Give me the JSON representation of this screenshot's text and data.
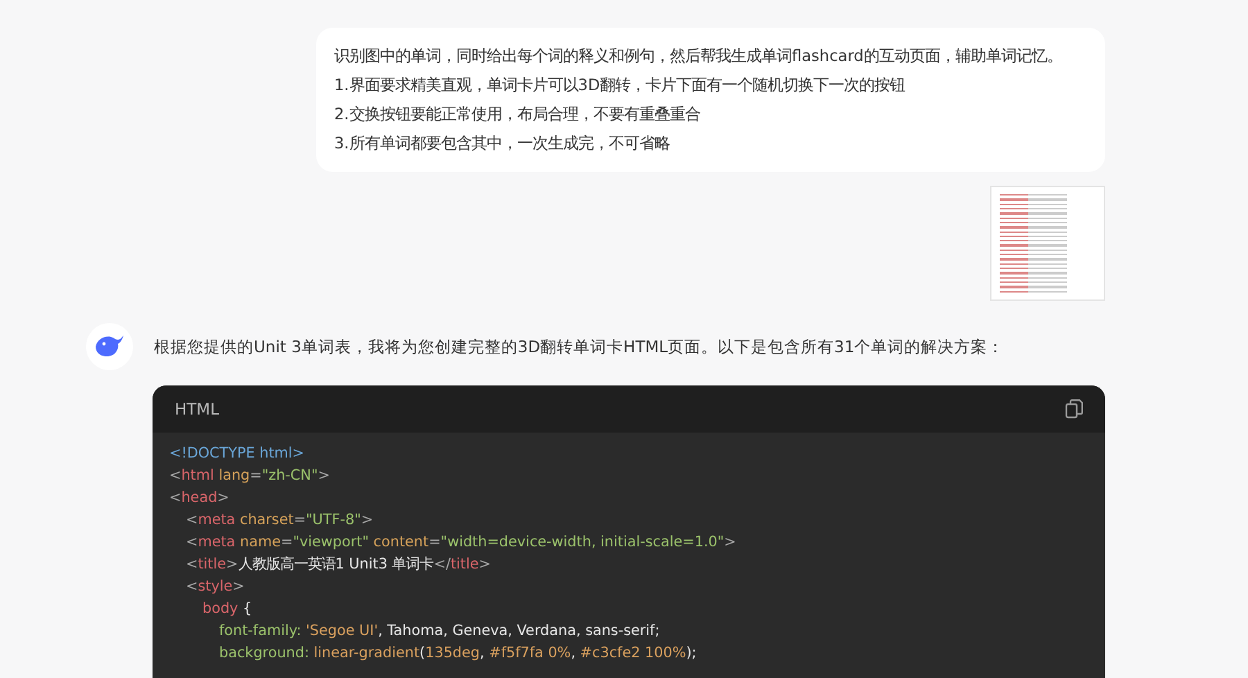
{
  "user_message": {
    "lines": [
      "识别图中的单词，同时给出每个词的释义和例句，然后帮我生成单词flashcard的互动页面，辅助单词记忆。",
      "1.界面要求精美直观，单词卡片可以3D翻转，卡片下面有一个随机切换下一次的按钮",
      "2.交换按钮要能正常使用，布局合理，不要有重叠重合",
      "3.所有单词都要包含其中，一次生成完，不可省略"
    ]
  },
  "assistant_message": {
    "text": "根据您提供的Unit 3单词表，我将为您创建完整的3D翻转单词卡HTML页面。以下是包含所有31个单词的解决方案：",
    "code_block": {
      "language": "HTML",
      "lines": [
        {
          "tokens": [
            {
              "kind": "doctype",
              "text": "<!DOCTYPE html>"
            }
          ]
        },
        {
          "tokens": [
            {
              "kind": "punct",
              "text": "<"
            },
            {
              "kind": "tag",
              "text": "html"
            },
            {
              "kind": "attr",
              "text": " lang"
            },
            {
              "kind": "punct",
              "text": "="
            },
            {
              "kind": "str",
              "text": "\"zh-CN\""
            },
            {
              "kind": "punct",
              "text": ">"
            }
          ]
        },
        {
          "tokens": [
            {
              "kind": "punct",
              "text": "<"
            },
            {
              "kind": "tag",
              "text": "head"
            },
            {
              "kind": "punct",
              "text": ">"
            }
          ],
          "children": [
            {
              "tokens": [
                {
                  "kind": "punct",
                  "text": "<"
                },
                {
                  "kind": "tag",
                  "text": "meta"
                },
                {
                  "kind": "attr",
                  "text": " charset"
                },
                {
                  "kind": "punct",
                  "text": "="
                },
                {
                  "kind": "str",
                  "text": "\"UTF-8\""
                },
                {
                  "kind": "punct",
                  "text": ">"
                }
              ]
            },
            {
              "tokens": [
                {
                  "kind": "punct",
                  "text": "<"
                },
                {
                  "kind": "tag",
                  "text": "meta"
                },
                {
                  "kind": "attr",
                  "text": " name"
                },
                {
                  "kind": "punct",
                  "text": "="
                },
                {
                  "kind": "str",
                  "text": "\"viewport\""
                },
                {
                  "kind": "attr",
                  "text": " content"
                },
                {
                  "kind": "punct",
                  "text": "="
                },
                {
                  "kind": "str",
                  "text": "\"width=device-width, initial-scale=1.0\""
                },
                {
                  "kind": "punct",
                  "text": ">"
                }
              ]
            },
            {
              "tokens": [
                {
                  "kind": "punct",
                  "text": "<"
                },
                {
                  "kind": "tag",
                  "text": "title"
                },
                {
                  "kind": "punct",
                  "text": ">"
                },
                {
                  "kind": "text",
                  "text": "人教版高一英语1 Unit3 单词卡"
                },
                {
                  "kind": "punct",
                  "text": "</"
                },
                {
                  "kind": "tag",
                  "text": "title"
                },
                {
                  "kind": "punct",
                  "text": ">"
                }
              ]
            },
            {
              "tokens": [
                {
                  "kind": "punct",
                  "text": "<"
                },
                {
                  "kind": "tag",
                  "text": "style"
                },
                {
                  "kind": "punct",
                  "text": ">"
                }
              ],
              "children": [
                {
                  "tokens": [
                    {
                      "kind": "tag",
                      "text": "body"
                    },
                    {
                      "kind": "text",
                      "text": " {"
                    }
                  ],
                  "children": [
                    {
                      "tokens": [
                        {
                          "kind": "prop",
                          "text": "font-family:"
                        },
                        {
                          "kind": "num",
                          "text": " 'Segoe UI'"
                        },
                        {
                          "kind": "text",
                          "text": ", Tahoma, Geneva, Verdana, sans-serif;"
                        }
                      ]
                    },
                    {
                      "tokens": [
                        {
                          "kind": "prop",
                          "text": "background:"
                        },
                        {
                          "kind": "num",
                          "text": " linear-gradient"
                        },
                        {
                          "kind": "text",
                          "text": "("
                        },
                        {
                          "kind": "num",
                          "text": "135deg"
                        },
                        {
                          "kind": "text",
                          "text": ", "
                        },
                        {
                          "kind": "num",
                          "text": "#f5f7fa 0%"
                        },
                        {
                          "kind": "text",
                          "text": ", "
                        },
                        {
                          "kind": "num",
                          "text": "#c3cfe2 100%"
                        },
                        {
                          "kind": "text",
                          "text": ");"
                        }
                      ]
                    }
                  ]
                }
              ]
            }
          ]
        }
      ]
    }
  }
}
